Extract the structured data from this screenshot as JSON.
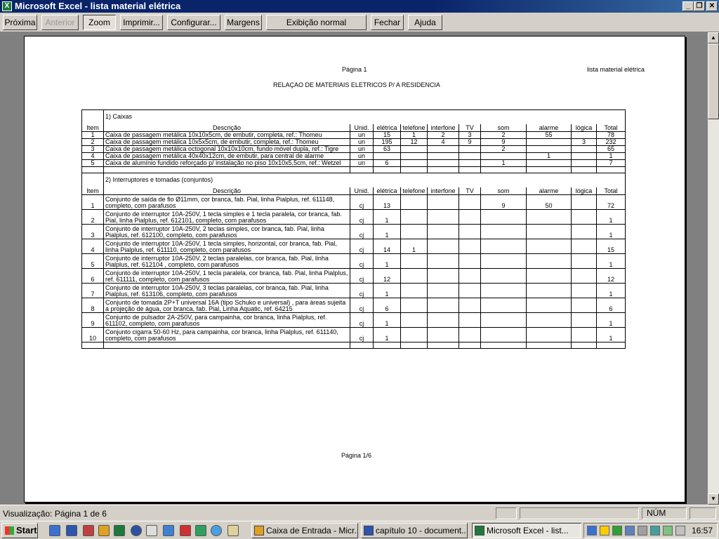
{
  "window": {
    "title": "Microsoft Excel - lista material elétrica",
    "icon": "excel-icon"
  },
  "toolbar": {
    "buttons": [
      "Próxima",
      "Anterior",
      "Zoom",
      "Imprimir...",
      "Configurar...",
      "Margens",
      "Exibição normal",
      "Fechar",
      "Ajuda"
    ]
  },
  "page": {
    "header_center": "Página 1",
    "header_right": "lista material elétrica",
    "title": "RELAÇAO DE MATERIAIS ELETRICOS P/ A RESIDENCIA",
    "footer": "Página 1/6"
  },
  "columns": [
    "Item",
    "Descrição",
    "Unid.",
    "elétrica",
    "telefone",
    "interfone",
    "TV",
    "som",
    "alarme",
    "lógica",
    "Total"
  ],
  "sections": [
    {
      "title": "1) Caixas",
      "rows": [
        {
          "item": "1",
          "desc": "Caixa de passagem metálica 10x10x5cm, de embutir, completa, ref.: Thomeu",
          "unid": "un",
          "eletrica": "15",
          "telefone": "1",
          "interfone": "2",
          "tv": "3",
          "som": "2",
          "alarme": "55",
          "logica": "",
          "total": "78"
        },
        {
          "item": "2",
          "desc": "Caixa de passagem metálica 10x5x5cm, de embutir, completa, ref.: Thomeu",
          "unid": "un",
          "eletrica": "195",
          "telefone": "12",
          "interfone": "4",
          "tv": "9",
          "som": "9",
          "alarme": "",
          "logica": "3",
          "total": "232"
        },
        {
          "item": "3",
          "desc": "Caixa de passagem metálica octogonal 10x10x10cm, fundo móvel dupla, ref.: Tigre",
          "unid": "un",
          "eletrica": "63",
          "telefone": "",
          "interfone": "",
          "tv": "",
          "som": "2",
          "alarme": "",
          "logica": "",
          "total": "65"
        },
        {
          "item": "4",
          "desc": "Caixa de passagem metálica 40x40x12cm, de embutir, para central de alarme",
          "unid": "un",
          "eletrica": "",
          "telefone": "",
          "interfone": "",
          "tv": "",
          "som": "",
          "alarme": "1",
          "logica": "",
          "total": "1"
        },
        {
          "item": "5",
          "desc": "Caixa de alumínio fundido reforçado p/ instalação no piso 10x10x5,5cm, ref.: Wetzel",
          "unid": "un",
          "eletrica": "6",
          "telefone": "",
          "interfone": "",
          "tv": "",
          "som": "1",
          "alarme": "",
          "logica": "",
          "total": "7"
        }
      ]
    },
    {
      "title": "2) Interruptores e tomadas (conjuntos)",
      "rows": [
        {
          "item": "1",
          "desc": "Conjunto de saída de fio Ø11mm, cor branca, fab. Pial, linha Pialplus, ref. 611148, completo, com parafusos",
          "unid": "cj",
          "eletrica": "13",
          "telefone": "",
          "interfone": "",
          "tv": "",
          "som": "9",
          "alarme": "50",
          "logica": "",
          "total": "72"
        },
        {
          "item": "2",
          "desc": "Conjunto de interruptor 10A-250V, 1 tecla simples e 1 tecla paralela, cor branca, fab. Pial, linha Pialplus, ref. 612101, completo, com parafusos",
          "unid": "cj",
          "eletrica": "1",
          "telefone": "",
          "interfone": "",
          "tv": "",
          "som": "",
          "alarme": "",
          "logica": "",
          "total": "1"
        },
        {
          "item": "3",
          "desc": "Conjunto de interruptor 10A-250V, 2 teclas simples, cor branca, fab. Pial, linha Pialplus, ref. 612100, completo, com parafusos",
          "unid": "cj",
          "eletrica": "1",
          "telefone": "",
          "interfone": "",
          "tv": "",
          "som": "",
          "alarme": "",
          "logica": "",
          "total": "1"
        },
        {
          "item": "4",
          "desc": "Conjunto de interruptor 10A-250V, 1 tecla simples, horizontal, cor branca, fab. Pial, linha Pialplus, ref. 611110, completo, com parafusos",
          "unid": "cj",
          "eletrica": "14",
          "telefone": "1",
          "interfone": "",
          "tv": "",
          "som": "",
          "alarme": "",
          "logica": "",
          "total": "15"
        },
        {
          "item": "5",
          "desc": "Conjunto de interruptor 10A-250V, 2 teclas paralelas, cor branca, fab. Pial, linha Pialplus, ref. 612104 , completo, com parafusos",
          "unid": "cj",
          "eletrica": "1",
          "telefone": "",
          "interfone": "",
          "tv": "",
          "som": "",
          "alarme": "",
          "logica": "",
          "total": "1"
        },
        {
          "item": "6",
          "desc": "Conjunto de interruptor 10A-250V, 1 tecla paralela, cor branca, fab. Pial, linha Pialplus, ref. 611111, completo, com parafusos",
          "unid": "cj",
          "eletrica": "12",
          "telefone": "",
          "interfone": "",
          "tv": "",
          "som": "",
          "alarme": "",
          "logica": "",
          "total": "12"
        },
        {
          "item": "7",
          "desc": "Conjunto de interruptor 10A-250V, 3 teclas paralelas, cor branca, fab. Pial, linha Pialplus, ref. 613106, completo, com parafusos",
          "unid": "cj",
          "eletrica": "1",
          "telefone": "",
          "interfone": "",
          "tv": "",
          "som": "",
          "alarme": "",
          "logica": "",
          "total": "1"
        },
        {
          "item": "8",
          "desc": "Conjunto de tomada 2P+T universal 16A (tipo Schuko e universal) , para áreas sujeita a projeção de água, cor branca, fab. Pial, Linha Aquatic, ref. 64215",
          "unid": "cj",
          "eletrica": "6",
          "telefone": "",
          "interfone": "",
          "tv": "",
          "som": "",
          "alarme": "",
          "logica": "",
          "total": "6"
        },
        {
          "item": "9",
          "desc": "Conjunto de pulsador 2A-250V, para campainha, cor branca, linha Pialplus, ref. 611102, completo, com parafusos",
          "unid": "cj",
          "eletrica": "1",
          "telefone": "",
          "interfone": "",
          "tv": "",
          "som": "",
          "alarme": "",
          "logica": "",
          "total": "1"
        },
        {
          "item": "10",
          "desc": "Conjunto cigarra 50-60 Hz, para campainha, cor branca, linha Pialplus, ref. 611140, completo, com parafusos",
          "unid": "cj",
          "eletrica": "1",
          "telefone": "",
          "interfone": "",
          "tv": "",
          "som": "",
          "alarme": "",
          "logica": "",
          "total": "1"
        }
      ]
    }
  ],
  "status": {
    "text": "Visualização: Página 1 de 6",
    "num": "NÚM"
  },
  "taskbar": {
    "start": "Start",
    "tasks": [
      "Caixa de Entrada - Micr...",
      "capítulo 10 - document...",
      "Microsoft Excel - list..."
    ],
    "clock": "16:57"
  }
}
